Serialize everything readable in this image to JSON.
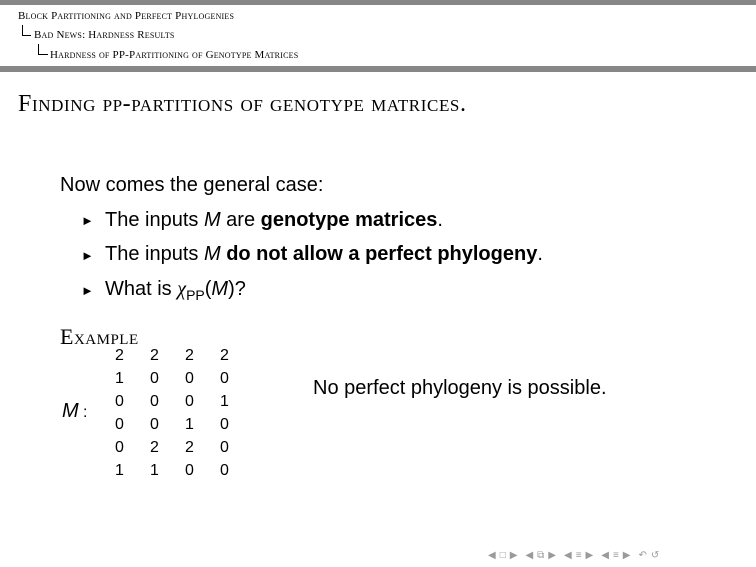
{
  "breadcrumb": {
    "level1": "Block Partitioning and Perfect Phylogenies",
    "level2": "Bad News: Hardness Results",
    "level3": "Hardness of PP-Partitioning of Genotype Matrices"
  },
  "frame": {
    "title": "Finding pp-partitions of genotype matrices."
  },
  "content": {
    "intro": "Now comes the general case:",
    "bullets": [
      {
        "prefix": "The inputs ",
        "var": "M",
        "middle": " are ",
        "bold": "genotype matrices",
        "suffix": "."
      },
      {
        "prefix": "The inputs ",
        "var": "M",
        "middle": " ",
        "bold": "do not allow a perfect phylogeny",
        "suffix": "."
      },
      {
        "prefix": "What is ",
        "chi": "χ",
        "sub": "PP",
        "open": "(",
        "var": "M",
        "close": ")?"
      }
    ]
  },
  "example": {
    "title": "Example",
    "matrix_label": "M",
    "matrix_colon": ":",
    "matrix": [
      [
        "2",
        "2",
        "2",
        "2"
      ],
      [
        "1",
        "0",
        "0",
        "0"
      ],
      [
        "0",
        "0",
        "0",
        "1"
      ],
      [
        "0",
        "0",
        "1",
        "0"
      ],
      [
        "0",
        "2",
        "2",
        "0"
      ],
      [
        "1",
        "1",
        "0",
        "0"
      ]
    ],
    "note": "No perfect phylogeny is possible."
  },
  "colors": {
    "bar": "#878787",
    "nav": "#9a9a9a"
  },
  "nav_icons": [
    "prev-frame-icon",
    "frame-icon",
    "next-frame-icon",
    "prev-subsection-icon",
    "subsection-icon",
    "next-subsection-icon",
    "prev-section-icon",
    "section-icon",
    "next-section-icon",
    "back-icon",
    "search-icon"
  ]
}
